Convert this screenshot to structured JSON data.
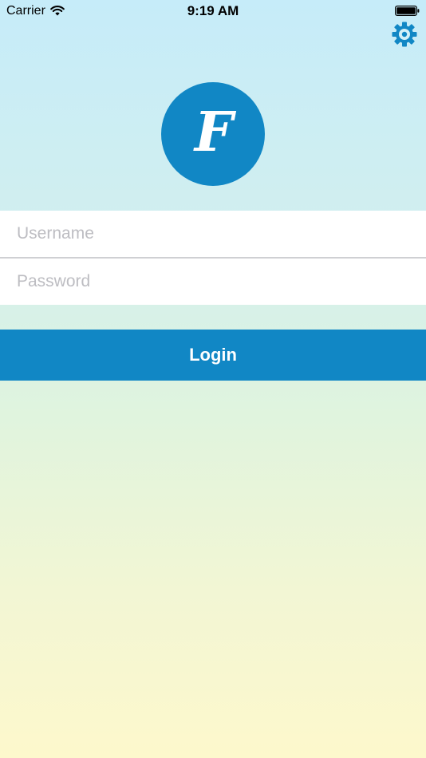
{
  "status_bar": {
    "carrier": "Carrier",
    "time": "9:19 AM",
    "icons": {
      "wifi": "wifi-icon",
      "battery": "battery-icon"
    }
  },
  "settings": {
    "icon": "gear-icon"
  },
  "logo": {
    "letter": "F"
  },
  "form": {
    "username": {
      "value": "",
      "placeholder": "Username"
    },
    "password": {
      "value": "",
      "placeholder": "Password"
    }
  },
  "login": {
    "label": "Login"
  },
  "colors": {
    "accent": "#1187c5",
    "field_background": "#ffffff",
    "placeholder": "#bdbdc2",
    "gradient_top": "#c6ecf9",
    "gradient_bottom": "#fdf8cc"
  }
}
